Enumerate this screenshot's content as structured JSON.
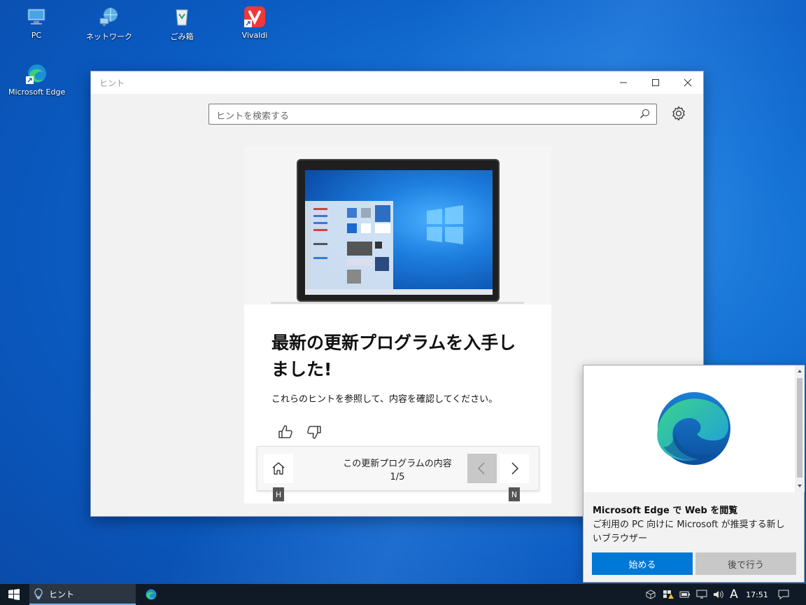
{
  "desktop": {
    "icons": [
      {
        "label": "PC"
      },
      {
        "label": "ネットワーク"
      },
      {
        "label": "ごみ箱"
      },
      {
        "label": "Vivaldi"
      },
      {
        "label": "Microsoft Edge"
      }
    ]
  },
  "window": {
    "title": "ヒント",
    "search_placeholder": "ヒントを検索する",
    "card": {
      "headline": "最新の更新プログラムを入手しました!",
      "subtext": "これらのヒントを参照して、内容を確認してください。"
    },
    "nav": {
      "title": "この更新プログラムの内容",
      "count": "1/5",
      "home_key": "H",
      "next_key": "N"
    }
  },
  "toast": {
    "title": "Microsoft Edge で Web を閲覧",
    "body": "ご利用の PC 向けに Microsoft が推奨する新しいブラウザー",
    "primary_button": "始める",
    "secondary_button": "後で行う"
  },
  "taskbar": {
    "app_label": "ヒント",
    "ime_indicator": "A",
    "clock": "17:51"
  },
  "colors": {
    "accent": "#0078d7",
    "taskbar": "#0f1a26"
  }
}
